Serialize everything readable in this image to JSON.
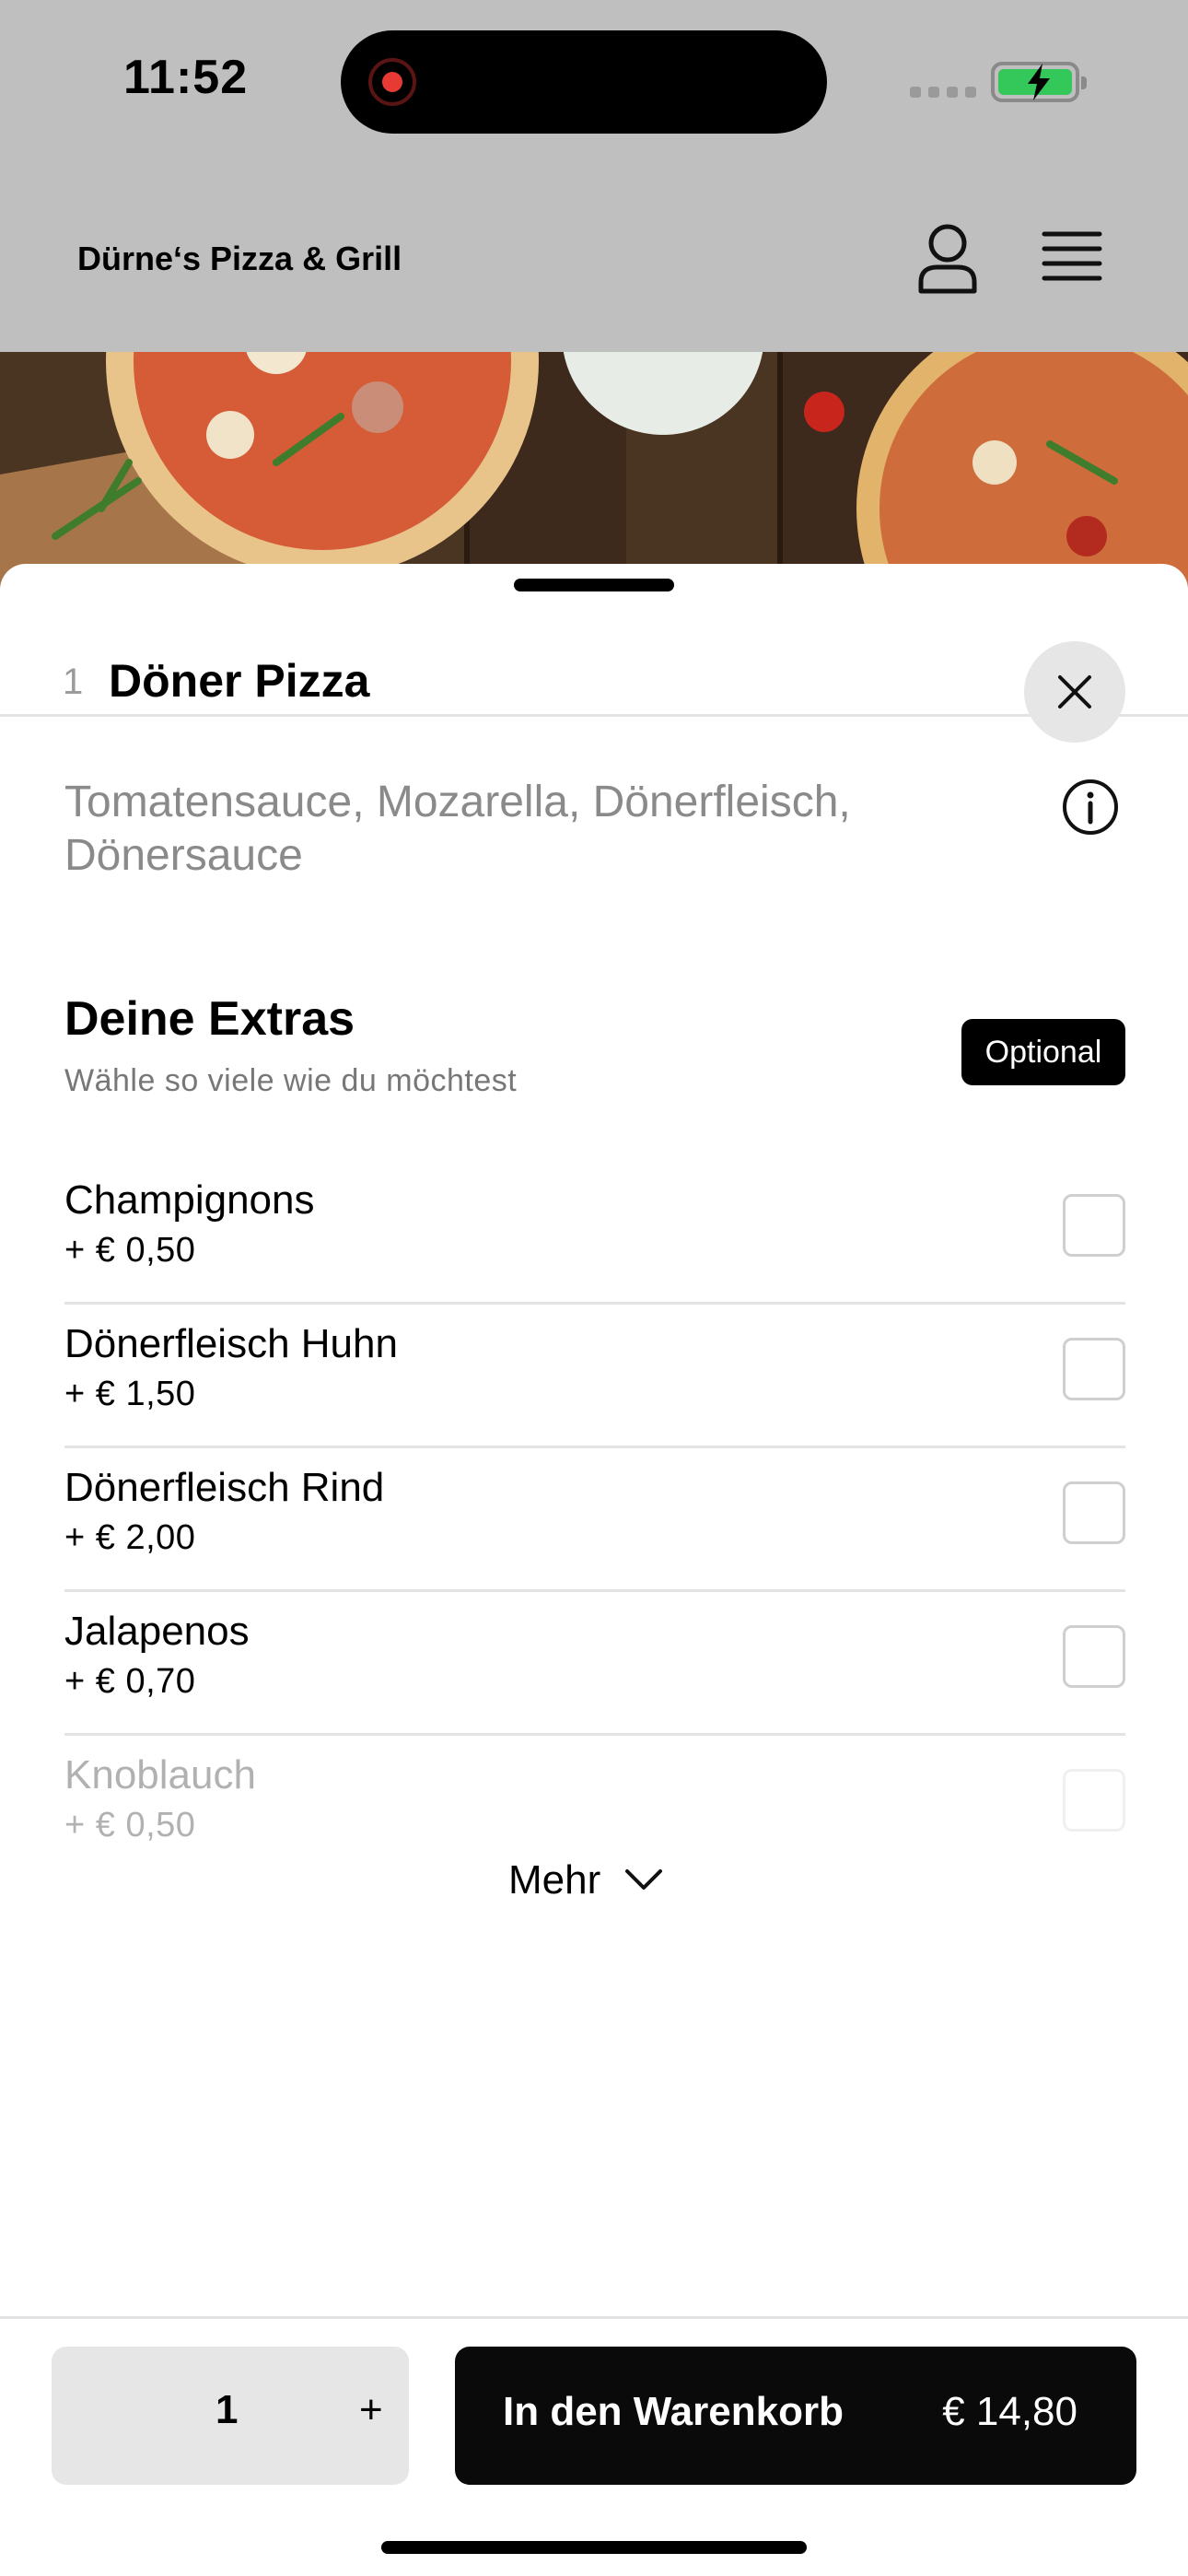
{
  "status_bar": {
    "time": "11:52"
  },
  "header": {
    "restaurant_name": "Dürne‘s Pizza & Grill"
  },
  "item": {
    "quantity": "1",
    "title": "Döner Pizza",
    "description": "Tomatensauce, Mozarella, Dönerfleisch, Dönersauce"
  },
  "extras": {
    "title": "Deine Extras",
    "subtitle": "Wähle so viele wie du möchtest",
    "badge": "Optional",
    "items": [
      {
        "name": "Champignons",
        "price": "+ € 0,50"
      },
      {
        "name": "Dönerfleisch Huhn",
        "price": "+ € 1,50"
      },
      {
        "name": "Dönerfleisch Rind",
        "price": "+ € 2,00"
      },
      {
        "name": "Jalapenos",
        "price": "+ € 0,70"
      },
      {
        "name": "Knoblauch",
        "price": "+ € 0,50"
      }
    ],
    "more_label": "Mehr"
  },
  "footer": {
    "quantity": "1",
    "plus": "+",
    "cart_label": "In den Warenkorb",
    "cart_total": "€ 14,80"
  },
  "colors": {
    "overlay_grey": "#bfbfbf",
    "primary": "#0a0a0a",
    "battery_green": "#34c759",
    "record_red": "#e83a35"
  },
  "icons": [
    "record-icon",
    "battery-icon",
    "profile-icon",
    "hamburger-menu-icon",
    "close-icon",
    "info-icon",
    "chevron-down-icon"
  ]
}
